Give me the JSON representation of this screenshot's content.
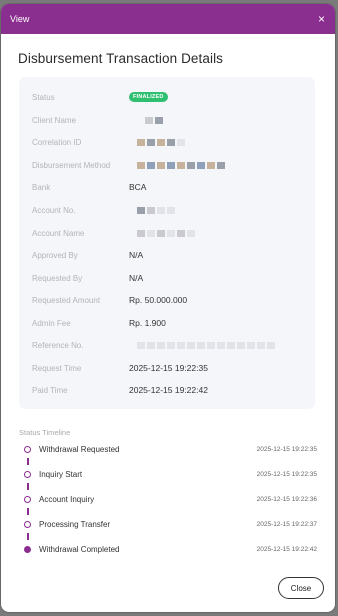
{
  "header": {
    "title": "View",
    "close_glyph": "×"
  },
  "page_title": "Disbursement Transaction Details",
  "details": {
    "status_label": "Status",
    "status_value": "FINALIZED",
    "client_name_label": "Client Name",
    "correlation_id_label": "Correlation ID",
    "method_label": "Disbursement Method",
    "bank_label": "Bank",
    "bank_value": "BCA",
    "account_no_label": "Account No.",
    "account_name_label": "Account Name",
    "approved_by_label": "Approved By",
    "approved_by_value": "N/A",
    "requested_by_label": "Requested By",
    "requested_by_value": "N/A",
    "requested_amount_label": "Requested Amount",
    "requested_amount_value": "Rp. 50.000.000",
    "admin_fee_label": "Admin Fee",
    "admin_fee_value": "Rp. 1.900",
    "reference_no_label": "Reference No.",
    "request_time_label": "Request Time",
    "request_time_value": "2025-12-15 19:22:35",
    "paid_time_label": "Paid Time",
    "paid_time_value": "2025-12-15 19:22:42"
  },
  "timeline": {
    "header": "Status Timeline",
    "items": [
      {
        "name": "Withdrawal Requested",
        "time": "2025-12-15 19:22:35"
      },
      {
        "name": "Inquiry Start",
        "time": "2025-12-15 19:22:35"
      },
      {
        "name": "Account Inquiry",
        "time": "2025-12-15 19:22:36"
      },
      {
        "name": "Processing Transfer",
        "time": "2025-12-15 19:22:37"
      },
      {
        "name": "Withdrawal Completed",
        "time": "2025-12-15 19:22:42"
      }
    ]
  },
  "footer": {
    "close_label": "Close"
  },
  "colors": {
    "header": "#8a2e8f",
    "status_badge": "#2fbf71",
    "timeline": "#8a2e8f"
  }
}
